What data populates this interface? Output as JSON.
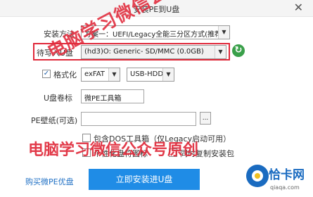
{
  "window": {
    "title": "安装PE到U盘"
  },
  "install_mode": {
    "label": "安装方法",
    "value": "方案一：UEFI/Legacy全能三分区方式(推荐)"
  },
  "target_disk": {
    "label": "待写入U盘",
    "value": "(hd3)O: Generic- SD/MMC (0.0GB)"
  },
  "format": {
    "label": "格式化",
    "checked": true,
    "filesystem": "exFAT",
    "mode": "USB-HDD"
  },
  "volume": {
    "label": "U盘卷标",
    "value": "微PE工具箱"
  },
  "wallpaper": {
    "label": "PE壁纸(可选)",
    "value": "",
    "browse_label": "..."
  },
  "options": [
    {
      "label": "包含DOS工具箱（仅Legacy启动可用）",
      "checked": false
    },
    {
      "label": "个性化盘符图标",
      "checked": false
    },
    {
      "label": "同时复制安装包",
      "checked": false
    }
  ],
  "buy_link": "购买微PE优盘",
  "install_button": "立即安装进U盘",
  "watermark": {
    "text1": "电脑学习微信公众号原创",
    "text2": "电脑学习微信公众号原创"
  },
  "logo": {
    "name": "恰卡网",
    "url": "qiaqa.com"
  },
  "colors": {
    "accent": "#1f8ce6",
    "highlight": "#e0293a"
  }
}
